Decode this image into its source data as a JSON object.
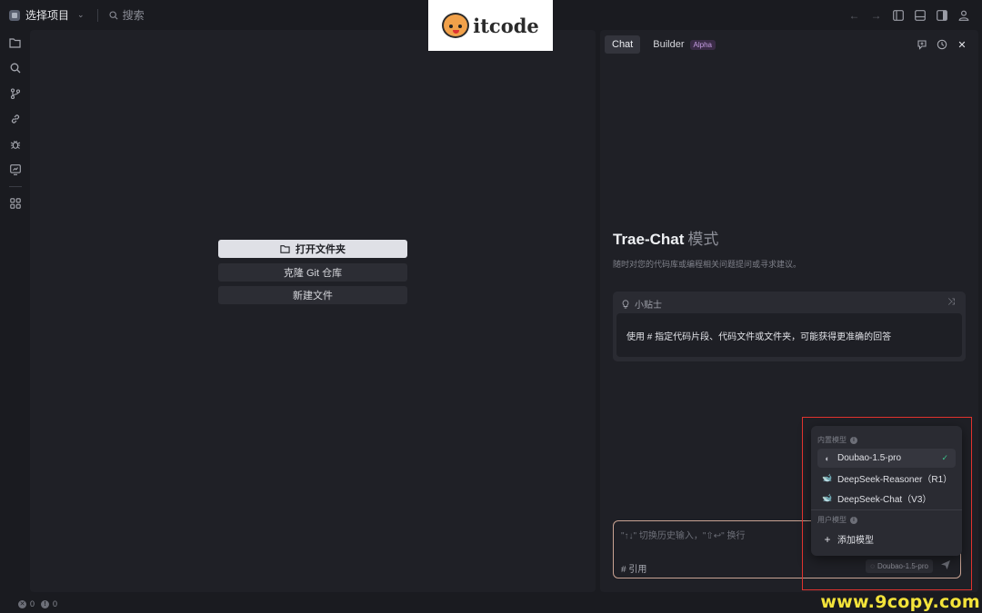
{
  "topbar": {
    "project_label": "选择项目",
    "search_placeholder": "搜索"
  },
  "welcome": {
    "open_folder": "打开文件夹",
    "clone_git": "克隆 Git 仓库",
    "new_file": "新建文件"
  },
  "chat": {
    "tabs": [
      {
        "label": "Chat",
        "active": true
      },
      {
        "label": "Builder",
        "badge": "Alpha"
      }
    ],
    "mode_title": "Trae-Chat",
    "mode_suffix": "模式",
    "mode_desc": "随时对您的代码库或编程相关问题提问或寻求建议。",
    "tips": {
      "header": "小贴士",
      "body": "使用 # 指定代码片段、代码文件或文件夹，可能获得更准确的回答"
    },
    "input": {
      "placeholder": "\"↑↓\" 切换历史输入，\"⇧↩\" 换行",
      "reference": "# 引用",
      "model_chip": "Doubao-1.5-pro"
    }
  },
  "model_dropdown": {
    "builtin_header": "内置模型",
    "builtin_models": [
      {
        "label": "Doubao-1.5-pro",
        "selected": true,
        "icon": "doubao-icon"
      },
      {
        "label": "DeepSeek-Reasoner（R1）",
        "selected": false,
        "icon": "deepseek-icon"
      },
      {
        "label": "DeepSeek-Chat（V3）",
        "selected": false,
        "icon": "deepseek-icon"
      }
    ],
    "user_header": "用户模型",
    "add_model": "添加模型"
  },
  "statusbar": {
    "errors": "0",
    "warnings": "0"
  },
  "overlay": {
    "logo_text": "itcode",
    "watermark": "www.9copy.com"
  },
  "colors": {
    "accent_check": "#3cc28a",
    "highlight_frame": "#e0332e",
    "alpha_badge": "#c69ee3",
    "watermark": "#f3e33a"
  }
}
